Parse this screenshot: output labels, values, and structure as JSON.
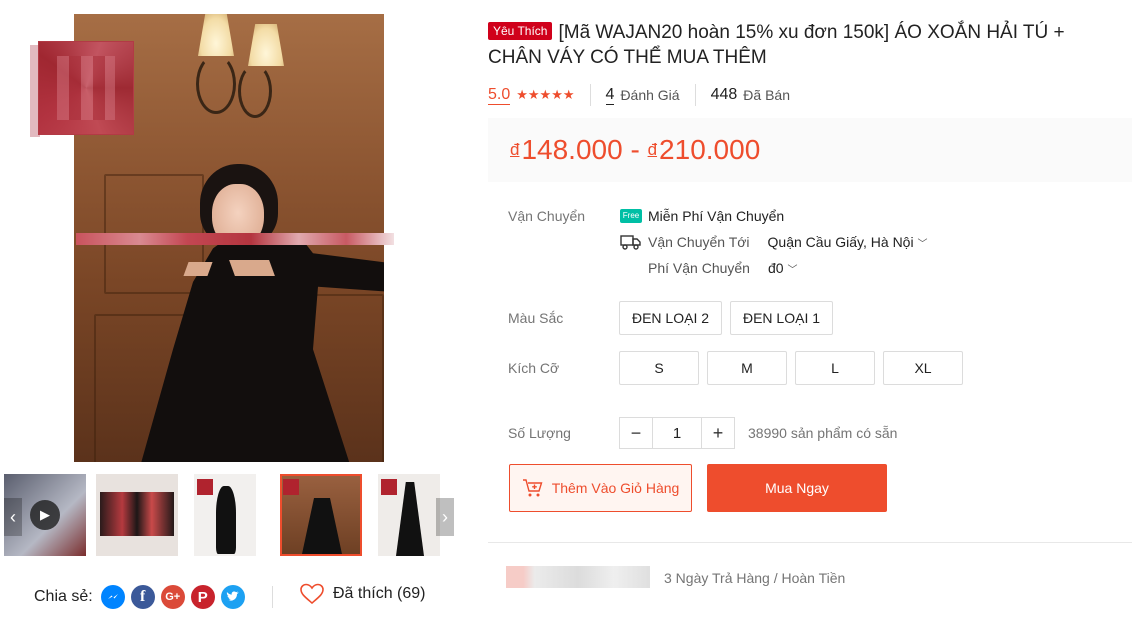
{
  "product": {
    "badge": "Yêu Thích",
    "title": "[Mã WAJAN20 hoàn 15% xu đơn 150k] ÁO XOẮN HẢI TÚ + CHÂN VÁY CÓ THỂ MUA THÊM",
    "rating": "5.0",
    "stars": "★★★★★",
    "reviews_count": "4",
    "reviews_label": "Đánh Giá",
    "sold_count": "448",
    "sold_label": "Đã Bán",
    "currency": "đ",
    "price_min": "148.000",
    "price_sep": " - ",
    "price_max": "210.000"
  },
  "shipping": {
    "label": "Vận Chuyển",
    "free_icon_text": "Free",
    "free_text": "Miễn Phí Vận Chuyển",
    "to_label": "Vận Chuyển Tới",
    "to_value": "Quận Cầu Giấy, Hà Nội",
    "fee_label": "Phí Vận Chuyển",
    "fee_value": "đ0"
  },
  "color": {
    "label": "Màu Sắc",
    "options": [
      "ĐEN LOẠI 2",
      "ĐEN LOẠI 1"
    ]
  },
  "size": {
    "label": "Kích Cỡ",
    "options": [
      "S",
      "M",
      "L",
      "XL"
    ]
  },
  "quantity": {
    "label": "Số Lượng",
    "minus": "−",
    "value": "1",
    "plus": "+",
    "stock": "38990 sản phẩm có sẵn"
  },
  "actions": {
    "add_to_cart": "Thêm Vào Giỏ Hàng",
    "buy_now": "Mua Ngay"
  },
  "guarantee": "3 Ngày Trả Hàng / Hoàn Tiền",
  "share": {
    "label": "Chia sẻ:",
    "networks": [
      "messenger-icon",
      "facebook-icon",
      "google-plus-icon",
      "pinterest-icon",
      "twitter-icon"
    ]
  },
  "like": {
    "label": "Đã thích (69)"
  },
  "gallery": {
    "prev": "‹",
    "next": "›"
  },
  "colors": {
    "accent": "#ee4d2d",
    "badge": "#d0011b",
    "price_bg": "#fafafa"
  }
}
